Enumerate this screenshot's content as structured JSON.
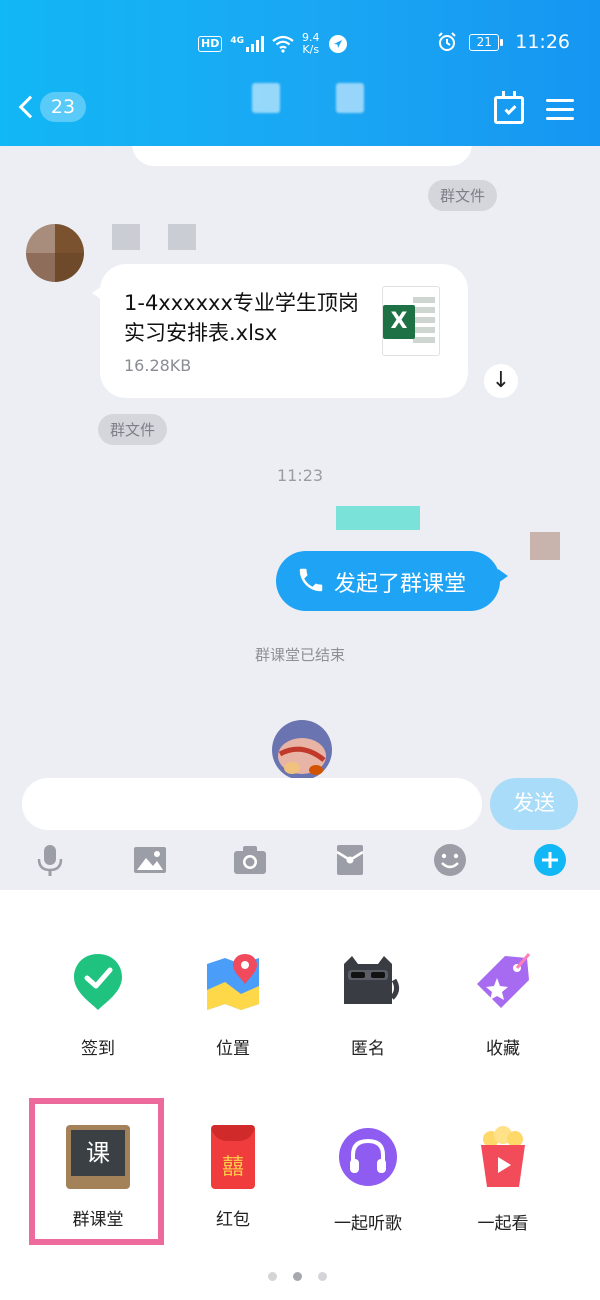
{
  "status_bar": {
    "hd_label": "HD",
    "network_type": "4G",
    "speed_value": "9.4",
    "speed_unit": "K/s",
    "battery": "21",
    "time": "11:26"
  },
  "header": {
    "unread_count": "23",
    "icons": [
      "back-chevron-icon",
      "calendar-icon",
      "menu-icon"
    ]
  },
  "chat": {
    "messages": [
      {
        "type": "tag",
        "text": "群文件"
      },
      {
        "type": "file",
        "file_name": "1-4xxxxxx专业学生顶岗实习安排表.xlsx",
        "file_size": "16.28KB",
        "file_icon": "excel-icon",
        "tag": "群文件"
      },
      {
        "type": "time",
        "text": "11:23"
      },
      {
        "type": "call",
        "text": "发起了群课堂",
        "icon": "phone-icon"
      },
      {
        "type": "system",
        "text": "群课堂已结束"
      }
    ]
  },
  "input": {
    "placeholder": "",
    "send_label": "发送"
  },
  "toolbar": {
    "icons": [
      "microphone-icon",
      "image-icon",
      "camera-icon",
      "red-packet-icon",
      "emoji-icon",
      "plus-icon"
    ]
  },
  "panel": {
    "apps": [
      {
        "label": "签到",
        "icon": "check-in-icon"
      },
      {
        "label": "位置",
        "icon": "location-icon"
      },
      {
        "label": "匿名",
        "icon": "anonymous-cat-icon"
      },
      {
        "label": "收藏",
        "icon": "favorite-tag-icon"
      },
      {
        "label": "群课堂",
        "icon": "blackboard-icon",
        "icon_text": "课",
        "highlighted": true
      },
      {
        "label": "红包",
        "icon": "red-envelope-icon",
        "icon_text": "囍"
      },
      {
        "label": "一起听歌",
        "icon": "headphones-icon"
      },
      {
        "label": "一起看",
        "icon": "popcorn-icon"
      }
    ],
    "page_count": 3,
    "current_page": 2
  },
  "colors": {
    "header_start": "#12b7f5",
    "header_end": "#1596f2",
    "bubble_blue": "#1fa3f4",
    "highlight": "#ec6a9c",
    "bg": "#eceef3"
  }
}
